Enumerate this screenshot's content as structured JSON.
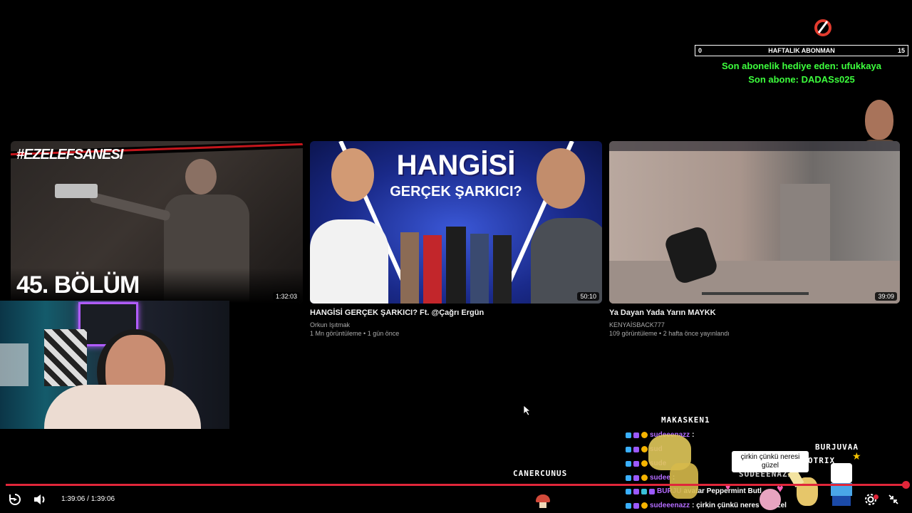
{
  "overlay": {
    "sub_goal": {
      "label": "HAFTALIK ABONMAN",
      "current": "0",
      "target": "15"
    },
    "last_gift": "Son abonelik hediye eden: ufukkaya",
    "last_sub": "Son abone: DADASs025"
  },
  "videos": [
    {
      "thumb_text_top": "#EZELEFSANESI",
      "thumb_text_bottom": "45. BÖLÜM",
      "duration": "1:32:03"
    },
    {
      "thumb_text_top": "HANGİSİ",
      "thumb_text_sub": "GERÇEK ŞARKICI?",
      "duration": "50:10",
      "title": "HANGİSİ GERÇEK ŞARKICI? Ft. @Çağrı Ergün",
      "channel": "Orkun Işıtmak",
      "stats": "1 Mn görüntüleme • 1 gün önce"
    },
    {
      "duration": "39:09",
      "title": "Ya Dayan Yada Yarın MAYKK",
      "channel": "KENYAİSBACK777",
      "stats": "109 görüntüleme • 2 hafta önce yayınlandı"
    }
  ],
  "chat": {
    "name_tags": [
      "MAKASKEN1",
      "BURJUVAA",
      "OTRIX",
      "SUDEEENAZZ",
      "CANERCUNUS"
    ],
    "bubble": "çirkin çünkü neresi güzel",
    "messages": [
      {
        "user": "sudeeenazz",
        "text": ":"
      },
      {
        "user": "sud",
        "text": ""
      },
      {
        "user": "sude",
        "text": ""
      },
      {
        "user": "sudee",
        "text": ":"
      },
      {
        "user": "BURJU",
        "text": "avatar Peppermint Butl"
      },
      {
        "user": "sudeeenazz",
        "text": ": çirkin çünkü neres",
        "tail": "zel"
      }
    ]
  },
  "player": {
    "time": "1:39:06 / 1:39:06",
    "progress": 1.0,
    "accent": "#e0263a"
  }
}
